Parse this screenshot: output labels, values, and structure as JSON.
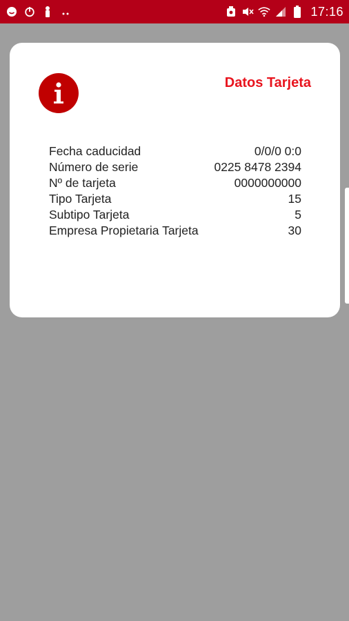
{
  "status_bar": {
    "time": "17:16",
    "left_icons": [
      "whatsapp-icon",
      "sync-icon",
      "figure-icon",
      "more-dots-icon"
    ],
    "right_icons": [
      "nfc-icon",
      "mute-icon",
      "wifi-icon",
      "signal-icon",
      "battery-icon"
    ]
  },
  "card": {
    "title": "Datos Tarjeta",
    "icon": "info-icon",
    "details": [
      {
        "label": "Fecha caducidad",
        "value": "0/0/0 0:0"
      },
      {
        "label": "Número de serie",
        "value": "0225 8478 2394"
      },
      {
        "label": "Nº de tarjeta",
        "value": "0000000000"
      },
      {
        "label": "Tipo Tarjeta",
        "value": "15"
      },
      {
        "label": "Subtipo Tarjeta",
        "value": "5"
      },
      {
        "label": "Empresa Propietaria Tarjeta",
        "value": "30"
      }
    ]
  },
  "colors": {
    "status_bar": "#b40018",
    "accent_red": "#e8141e",
    "info_icon_red": "#c00000",
    "backdrop": "#9e9e9e"
  }
}
